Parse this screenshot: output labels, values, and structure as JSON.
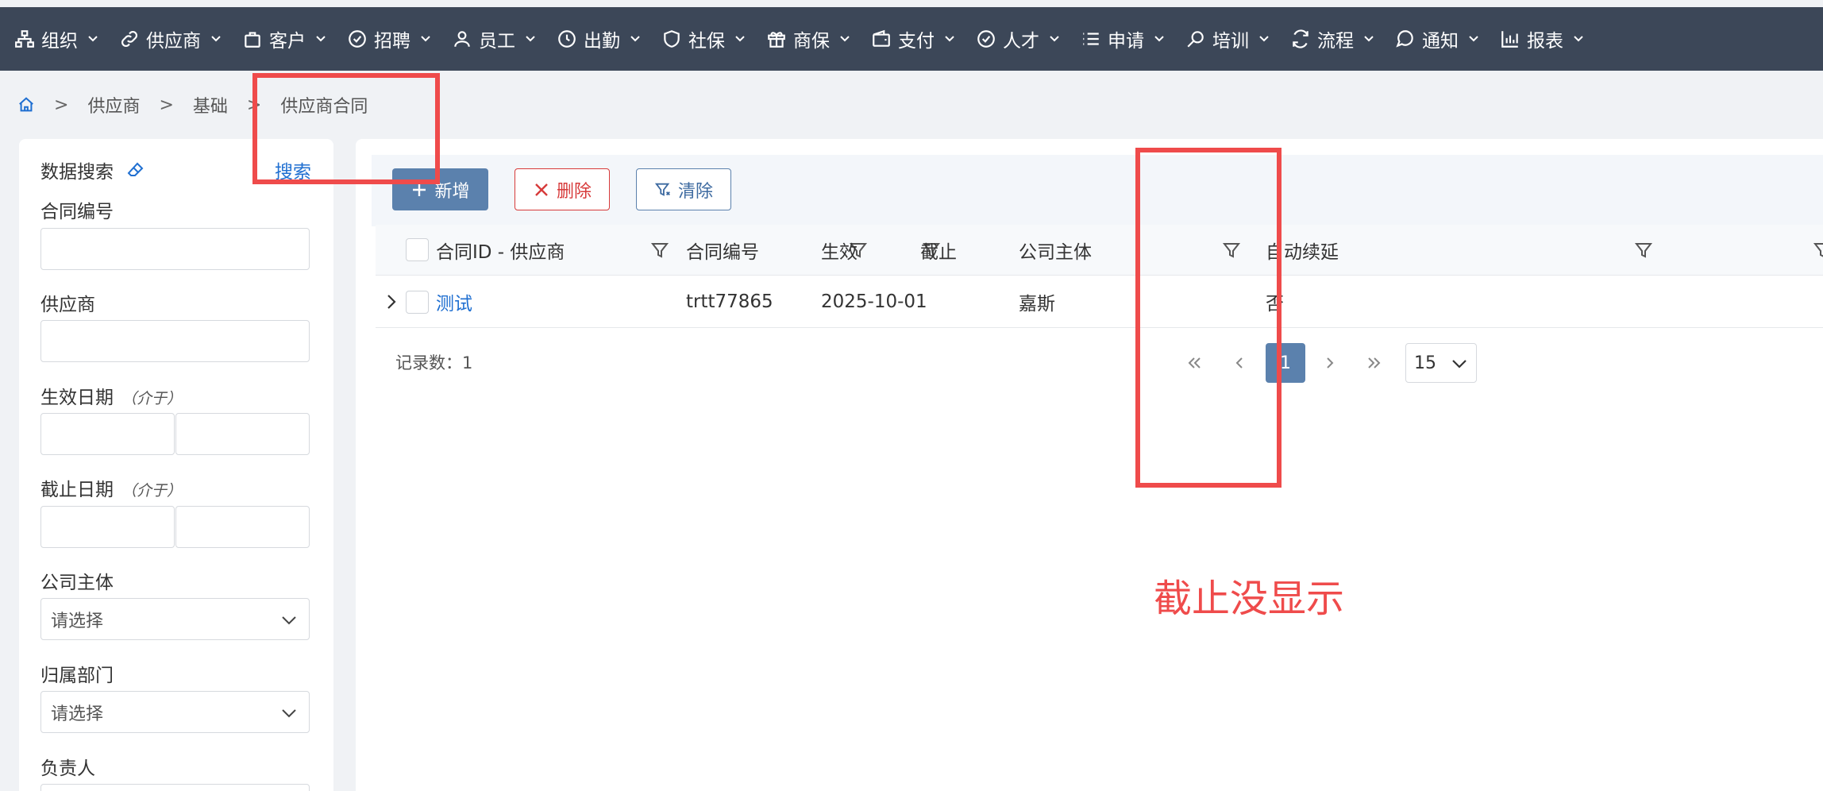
{
  "nav": {
    "items": [
      {
        "label": "组织",
        "icon": "org-icon"
      },
      {
        "label": "供应商",
        "icon": "link-icon"
      },
      {
        "label": "客户",
        "icon": "bag-icon"
      },
      {
        "label": "招聘",
        "icon": "check-circle-icon"
      },
      {
        "label": "员工",
        "icon": "user-icon"
      },
      {
        "label": "出勤",
        "icon": "clock-icon"
      },
      {
        "label": "社保",
        "icon": "shield-icon"
      },
      {
        "label": "商保",
        "icon": "gift-icon"
      },
      {
        "label": "支付",
        "icon": "wallet-icon"
      },
      {
        "label": "人才",
        "icon": "check-circle-icon"
      },
      {
        "label": "申请",
        "icon": "list-icon"
      },
      {
        "label": "培训",
        "icon": "search-icon"
      },
      {
        "label": "流程",
        "icon": "refresh-icon"
      },
      {
        "label": "通知",
        "icon": "chat-icon"
      },
      {
        "label": "报表",
        "icon": "bar-chart-icon"
      }
    ]
  },
  "breadcrumb": {
    "items": [
      "供应商",
      "基础",
      "供应商合同"
    ],
    "separator": ">"
  },
  "search": {
    "title": "数据搜索",
    "search_label": "搜索",
    "fields": {
      "contract_no": "合同编号",
      "supplier": "供应商",
      "effective_date": "生效日期",
      "end_date": "截止日期",
      "range_hint": "（介于）",
      "company": "公司主体",
      "department": "归属部门",
      "owner": "负责人"
    },
    "select_placeholder": "请选择"
  },
  "toolbar": {
    "add": "新增",
    "delete": "删除",
    "clear": "清除"
  },
  "table": {
    "columns": [
      "合同ID - 供应商",
      "合同编号",
      "生效",
      "截止",
      "公司主体",
      "自动续延"
    ],
    "rows": [
      {
        "id_supplier": "测试",
        "contract_no": "trtt77865",
        "effective": "2025-10-01",
        "end": "",
        "company": "嘉斯",
        "auto_renew": "否"
      }
    ]
  },
  "footer": {
    "record_count": "记录数：1",
    "current_page": "1",
    "page_size": "15"
  },
  "annotation": {
    "text": "截止没显示",
    "color": "#ef4b4b"
  },
  "colors": {
    "nav_bg": "#3c4758",
    "primary": "#5b81ad",
    "link": "#1f6fd1",
    "danger": "#d73a3a"
  }
}
